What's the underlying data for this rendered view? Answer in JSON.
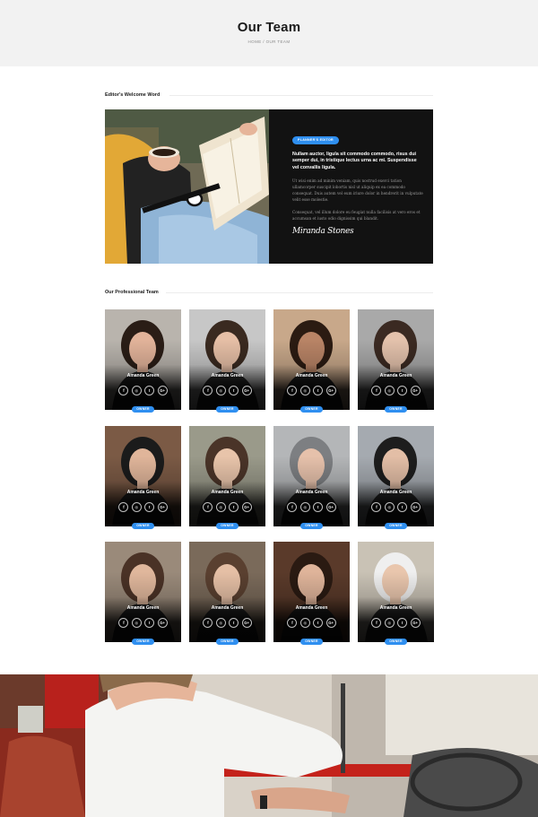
{
  "header": {
    "title": "Our Team",
    "breadcrumb": {
      "home": "HOME",
      "separator": "/",
      "current": "OUR TEAM"
    }
  },
  "editor_section": {
    "heading": "Editor's Welcome Word",
    "tag": "PLANNER'S EDITOR",
    "lead": "Nullam auctor, ligula sit commodo commodo, risus dui semper dui, in tristique lectus urna ac mi. Suspendisse vel convallis ligula.",
    "paragraph_1": "Ut wisi enim ad minim veniam, quis nostrud exerci tation ullamcorper suscipit lobortis nisl ut aliquip ex ea commodo consequat. Duis autem vel eum iriure dolor in hendrerit in vulputate velit esse molestie.",
    "paragraph_2": "Consequat, vel illum dolore eu feugiat nulla facilisis at vero eros et accumsan et iusto odio dignissim qui blandit.",
    "signature": "Miranda Stones"
  },
  "team_section": {
    "heading": "Our Professional Team",
    "social_icons": [
      "f",
      "◎",
      "t",
      "G+"
    ],
    "members": [
      {
        "name": "Amanda Green",
        "role": "OWNER"
      },
      {
        "name": "Amanda Green",
        "role": "OWNER"
      },
      {
        "name": "Amanda Green",
        "role": "OWNER"
      },
      {
        "name": "Amanda Green",
        "role": "OWNER"
      },
      {
        "name": "Amanda Green",
        "role": "OWNER"
      },
      {
        "name": "Amanda Green",
        "role": "OWNER"
      },
      {
        "name": "Amanda Green",
        "role": "OWNER"
      },
      {
        "name": "Amanda Green",
        "role": "OWNER"
      },
      {
        "name": "Amanda Green",
        "role": "OWNER"
      },
      {
        "name": "Amanda Green",
        "role": "OWNER"
      },
      {
        "name": "Amanda Green",
        "role": "OWNER"
      },
      {
        "name": "Amanda Green",
        "role": "OWNER"
      }
    ]
  },
  "colors": {
    "accent": "#2f8ff0",
    "editor_bg": "#121212",
    "header_bg": "#f2f2f2"
  }
}
